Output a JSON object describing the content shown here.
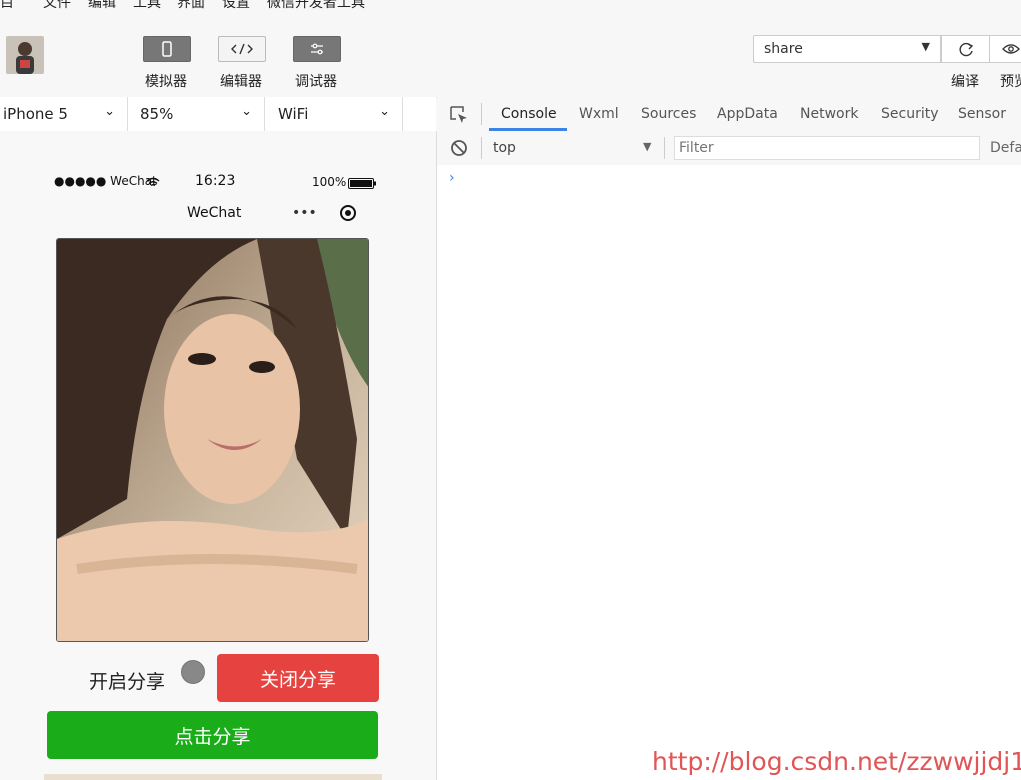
{
  "menu": [
    "项目",
    "文件",
    "编辑",
    "工具",
    "界面",
    "设置",
    "微信开发者工具"
  ],
  "toolbar": {
    "simulator_label": "模拟器",
    "editor_label": "编辑器",
    "debugger_label": "调试器",
    "project_value": "share",
    "compile_label": "编译",
    "preview_label": "预览"
  },
  "device": {
    "model": "iPhone 5",
    "zoom": "85%",
    "network": "WiFi"
  },
  "phone": {
    "carrier": "●●●●● WeChat",
    "time": "16:23",
    "battery": "100%",
    "nav_title": "WeChat",
    "nav_dots": "•••",
    "share_on_label": "开启分享",
    "close_share_button": "关闭分享",
    "share_button": "点击分享"
  },
  "devtools": {
    "tabs": [
      "Console",
      "Wxml",
      "Sources",
      "AppData",
      "Network",
      "Security",
      "Sensor"
    ],
    "active_tab": "Console",
    "context": "top",
    "filter_placeholder": "Filter",
    "levels": "Defa",
    "prompt": "›"
  },
  "watermark": "http://blog.csdn.net/zzwwjjdj1",
  "colors": {
    "accent": "#3b84e6",
    "red_button": "#e64340",
    "green_button": "#1aad19"
  }
}
